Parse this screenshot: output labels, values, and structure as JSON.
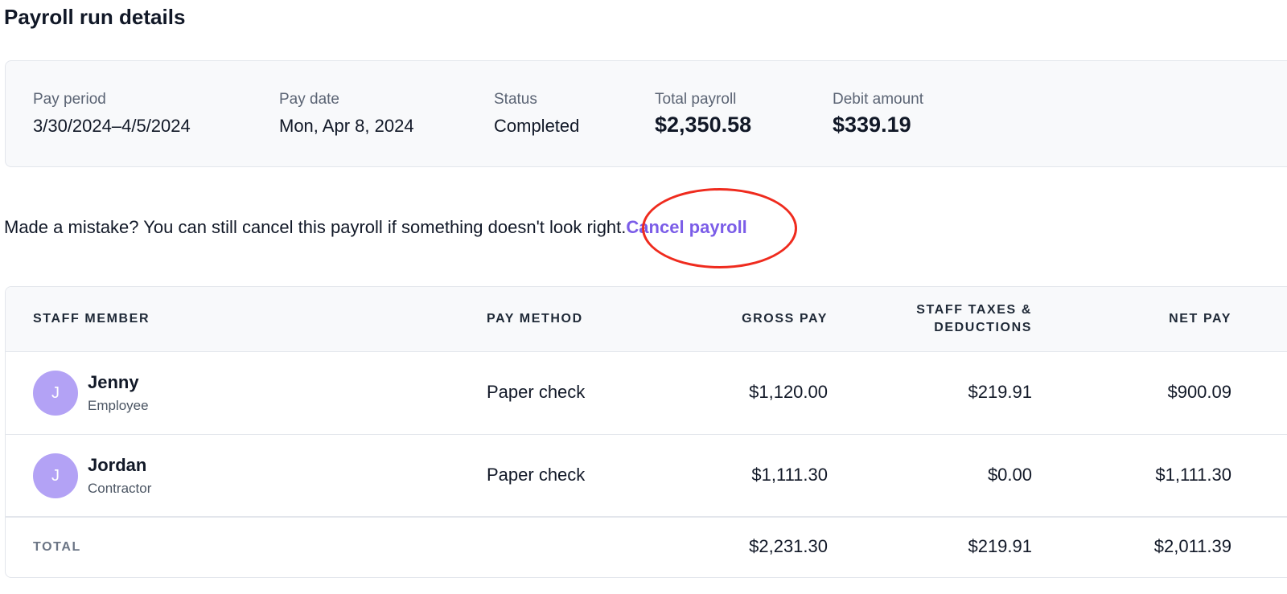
{
  "page": {
    "title": "Payroll run details"
  },
  "summary": {
    "pay_period": {
      "label": "Pay period",
      "value": "3/30/2024–4/5/2024"
    },
    "pay_date": {
      "label": "Pay date",
      "value": "Mon, Apr 8, 2024"
    },
    "status": {
      "label": "Status",
      "value": "Completed"
    },
    "total_payroll": {
      "label": "Total payroll",
      "value": "$2,350.58"
    },
    "debit_amount": {
      "label": "Debit amount",
      "value": "$339.19"
    }
  },
  "notice": {
    "text": "Made a mistake? You can still cancel this payroll if something doesn't look right.",
    "link_label": "Cancel payroll"
  },
  "colors": {
    "link": "#7b5de8",
    "highlight": "#ef2b1e",
    "avatar": "#b3a2f5"
  },
  "table": {
    "headers": {
      "staff": "STAFF MEMBER",
      "method": "PAY METHOD",
      "gross": "GROSS PAY",
      "taxes_line1": "STAFF TAXES &",
      "taxes_line2": "DEDUCTIONS",
      "net": "NET PAY"
    },
    "rows": [
      {
        "initial": "J",
        "name": "Jenny",
        "role": "Employee",
        "method": "Paper check",
        "gross": "$1,120.00",
        "taxes": "$219.91",
        "net": "$900.09"
      },
      {
        "initial": "J",
        "name": "Jordan",
        "role": "Contractor",
        "method": "Paper check",
        "gross": "$1,111.30",
        "taxes": "$0.00",
        "net": "$1,111.30"
      }
    ],
    "total": {
      "label": "TOTAL",
      "gross": "$2,231.30",
      "taxes": "$219.91",
      "net": "$2,011.39"
    }
  }
}
